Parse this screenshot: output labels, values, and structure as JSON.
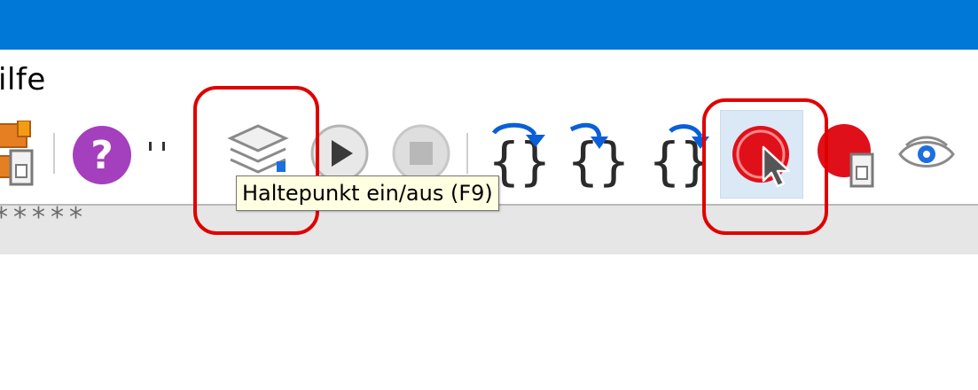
{
  "menu": {
    "visible_item": "ilfe"
  },
  "toolbar": {
    "tooltip": "Haltepunkt ein/aus (F9)",
    "help_glyph": "?",
    "step_into_glyph": "{}"
  },
  "status": {
    "stars": "*****"
  },
  "colors": {
    "titlebar": "#0078d7",
    "callout": "#e00000",
    "breakpoint": "#e0101a",
    "step_arrows": "#0a5fd8",
    "help": "#a43fbd"
  },
  "icons": {
    "menu_help": "question-icon",
    "layers": "layers-icon",
    "run": "play-icon",
    "stop": "stop-icon",
    "step_over": "step-over-icon",
    "step_into": "step-into-icon",
    "step_out": "step-out-icon",
    "breakpoint": "breakpoint-icon",
    "breakpoint_window": "breakpoint-window-icon",
    "watch": "eye-icon",
    "cursor": "mouse-cursor-icon"
  }
}
